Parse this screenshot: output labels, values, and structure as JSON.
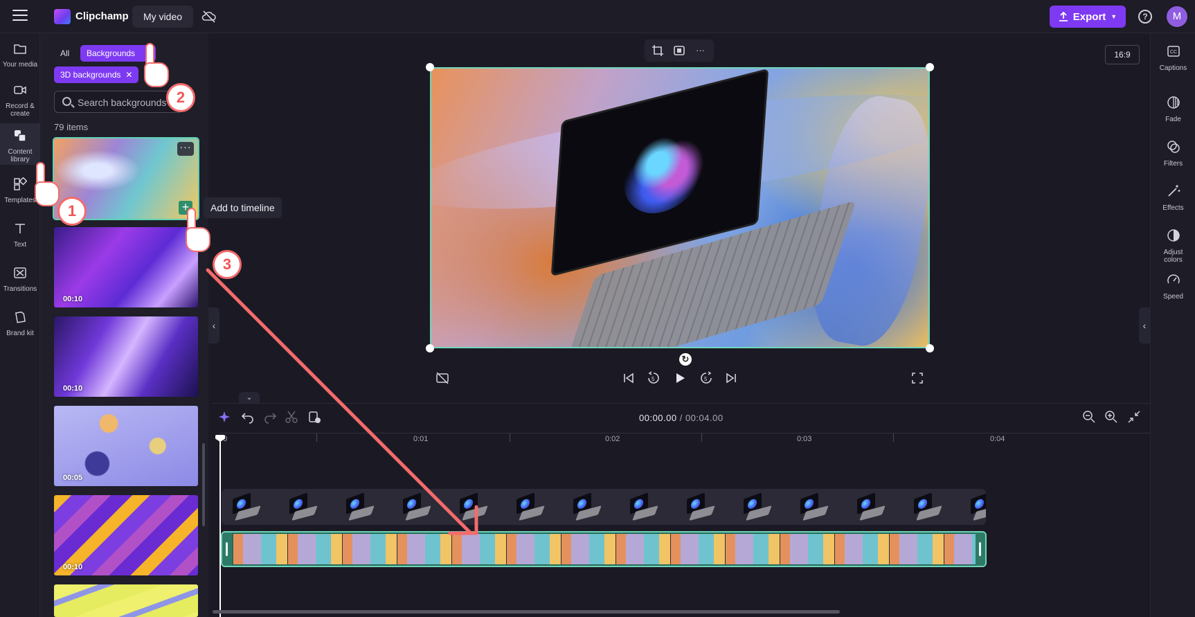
{
  "topbar": {
    "brand": "Clipchamp",
    "project_name": "My video",
    "export_label": "Export",
    "help_label": "?",
    "avatar_initial": "M"
  },
  "left_rail": {
    "items": [
      {
        "label": "Your media",
        "icon": "folder-icon"
      },
      {
        "label": "Record & create",
        "icon": "video-camera-icon"
      },
      {
        "label": "Content library",
        "icon": "content-library-icon",
        "active": true
      },
      {
        "label": "Templates",
        "icon": "templates-icon"
      },
      {
        "label": "Text",
        "icon": "text-icon"
      },
      {
        "label": "Transitions",
        "icon": "transitions-icon"
      },
      {
        "label": "Brand kit",
        "icon": "brand-kit-icon"
      }
    ]
  },
  "library": {
    "chip_all": "All",
    "chip_backgrounds": "Backgrounds",
    "chip_3d": "3D backgrounds",
    "chip_close": "✕",
    "search_placeholder": "Search backgrounds",
    "item_count": "79 items",
    "thumbnails": [
      {
        "duration": "",
        "selected": true
      },
      {
        "duration": "00:10"
      },
      {
        "duration": "00:10"
      },
      {
        "duration": "00:05"
      },
      {
        "duration": "00:10"
      },
      {
        "duration": ""
      }
    ],
    "more_label": "···",
    "add_label": "+",
    "tooltip": "Add to timeline"
  },
  "preview": {
    "aspect_ratio": "16:9",
    "toolbar_more": "···"
  },
  "timeline": {
    "current_time": "00:00.00",
    "separator": " / ",
    "total_time": "00:04.00",
    "ruler": [
      "0",
      "0:01",
      "0:02",
      "0:03",
      "0:04"
    ]
  },
  "right_rail": {
    "items": [
      {
        "label": "Captions",
        "icon": "captions-icon"
      },
      {
        "label": "Fade",
        "icon": "fade-icon"
      },
      {
        "label": "Filters",
        "icon": "filters-icon"
      },
      {
        "label": "Effects",
        "icon": "effects-icon"
      },
      {
        "label": "Adjust colors",
        "icon": "adjust-colors-icon"
      },
      {
        "label": "Speed",
        "icon": "speed-icon"
      }
    ]
  },
  "annotations": {
    "step1": "1",
    "step2": "2",
    "step3": "3",
    "arrow_color": "#f36b6b"
  },
  "colors": {
    "accent": "#7e3af2",
    "selection": "#6fd6ba",
    "background": "#1b1a24"
  }
}
